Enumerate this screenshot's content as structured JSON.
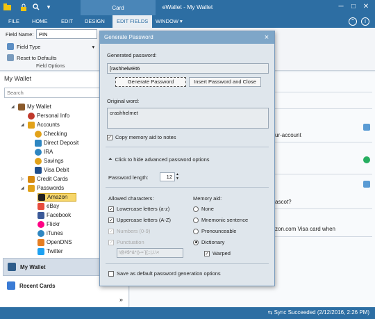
{
  "window": {
    "title": "eWallet - My Wallet",
    "context_tab": "Card",
    "quick_access_icons": [
      "folder-icon",
      "lock-icon",
      "search-icon",
      "dropdown-icon"
    ],
    "controls": [
      "minimize-icon",
      "maximize-icon",
      "close-icon",
      "info-icon"
    ]
  },
  "ribbon": {
    "tabs": [
      "FILE",
      "HOME",
      "EDIT",
      "DESIGN",
      "EDIT FIELDS",
      "WINDOW ▾"
    ],
    "active_tab": "EDIT FIELDS",
    "field_name_label": "Field Name:",
    "field_name_value": "PIN",
    "field_type_label": "Field Type",
    "reset_label": "Reset to Defaults",
    "group_label": "Field Options"
  },
  "left_pane": {
    "title": "My Wallet",
    "search_placeholder": "Search",
    "tree": [
      {
        "label": "My Wallet",
        "icon": "wallet-icon",
        "color": "#8a5a2b"
      },
      {
        "label": "Personal Info",
        "icon": "person-icon",
        "color": "#c0392b"
      },
      {
        "label": "Accounts",
        "icon": "accounts-icon",
        "color": "#e2a21a"
      },
      {
        "label": "Checking",
        "icon": "coins-icon",
        "color": "#e2a21a"
      },
      {
        "label": "Direct Deposit",
        "icon": "deposit-icon",
        "color": "#2e86c1"
      },
      {
        "label": "IRA",
        "icon": "info-icon",
        "color": "#2e86c1"
      },
      {
        "label": "Savings",
        "icon": "coins-icon",
        "color": "#e2a21a"
      },
      {
        "label": "Visa Debit",
        "icon": "card-icon",
        "color": "#1f4e8c"
      },
      {
        "label": "Credit Cards",
        "icon": "card-icon",
        "color": "#d68910"
      },
      {
        "label": "Passwords",
        "icon": "key-icon",
        "color": "#e2a21a"
      },
      {
        "label": "Amazon",
        "icon": "amazon-icon",
        "color": "#222222"
      },
      {
        "label": "eBay",
        "icon": "ebay-icon",
        "color": "#e74c3c"
      },
      {
        "label": "Facebook",
        "icon": "facebook-icon",
        "color": "#3b5998"
      },
      {
        "label": "Flickr",
        "icon": "flickr-icon",
        "color": "#ff0084"
      },
      {
        "label": "iTunes",
        "icon": "itunes-icon",
        "color": "#2e86c1"
      },
      {
        "label": "OpenDNS",
        "icon": "opendns-icon",
        "color": "#e67e22"
      },
      {
        "label": "Twitter",
        "icon": "twitter-icon",
        "color": "#1da1f2"
      }
    ],
    "nav_my_wallet": "My Wallet",
    "nav_recent_cards": "Recent Cards",
    "nav_more": "»"
  },
  "right_pane": {
    "fragments": [
      "ur-account",
      "ascot?",
      "zon.com Visa card when"
    ]
  },
  "status": {
    "text": "Sync Succeeded (2/12/2016, 2:26 PM)"
  },
  "dialog": {
    "title": "Generate Password",
    "close": "×",
    "generated_label": "Generated password:",
    "generated_value": "[rashhelwEt6",
    "generate_button": "Generate Password",
    "insert_button": "Insert Password and Close",
    "original_label": "Original word:",
    "original_value": "crashhelmet",
    "copy_memory_aid": "Copy memory aid to notes",
    "advanced_toggle": "Click to hide advanced password options",
    "length_label": "Password length:",
    "length_value": "12",
    "allowed_label": "Allowed characters:",
    "lowercase": "Lowercase letters (a-z)",
    "uppercase": "Uppercase letters (A-Z)",
    "numbers": "Numbers (0-9)",
    "punctuation": "Punctuation",
    "punctuation_chars": "!@#$^&*()-=`[{;:|,\\.\\<",
    "memory_aid_label": "Memory aid:",
    "mem_none": "None",
    "mem_mnemonic": "Mnemonic sentence",
    "mem_pronounceable": "Pronounceable",
    "mem_dictionary": "Dictionary",
    "mem_warped": "Warped",
    "save_default": "Save as default password generation options"
  }
}
